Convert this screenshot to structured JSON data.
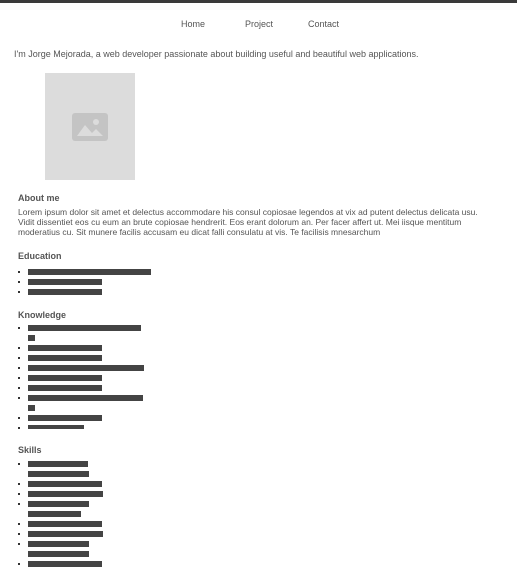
{
  "nav": {
    "home": "Home",
    "project": "Project",
    "contact": "Contact"
  },
  "intro": "I'm Jorge Mejorada, a web developer passionate about building useful and beautiful web applications.",
  "photo": {
    "icon": "image-placeholder-icon"
  },
  "about": {
    "title": "About me",
    "text": "Lorem ipsum dolor sit amet et delectus accommodare his consul copiosae legendos at vix ad putent delectus delicata usu. Vidit dissentiet eos cu eum an brute copiosae hendrerit. Eos erant dolorum an. Per facer affert ut. Mei iisque mentitum moderatius cu. Sit munere facilis accusam eu dicat falli consulatu at vis. Te facilisis mnesarchum"
  },
  "education": {
    "title": "Education"
  },
  "knowledge": {
    "title": "Knowledge"
  },
  "skills": {
    "title": "Skills"
  },
  "colors": {
    "text": "#555555",
    "bar": "#444444",
    "placeholder": "#dcdcdc",
    "top_border": "#3a3a3a"
  }
}
